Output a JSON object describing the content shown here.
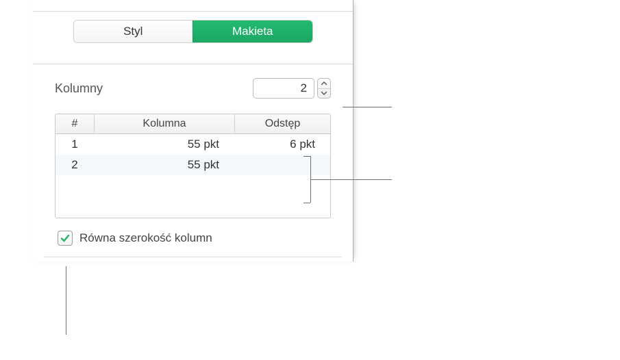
{
  "tabs": {
    "style": "Styl",
    "layout": "Makieta"
  },
  "columns": {
    "label": "Kolumny",
    "value": "2"
  },
  "table": {
    "headers": {
      "num": "#",
      "col": "Kolumna",
      "gap": "Odstęp"
    },
    "rows": [
      {
        "num": "1",
        "col": "55 pkt",
        "gap": "6 pkt"
      },
      {
        "num": "2",
        "col": "55 pkt",
        "gap": ""
      }
    ]
  },
  "equalWidth": {
    "label": "Równa szerokość kolumn",
    "checked": true
  },
  "colors": {
    "accent": "#1fb36b"
  }
}
